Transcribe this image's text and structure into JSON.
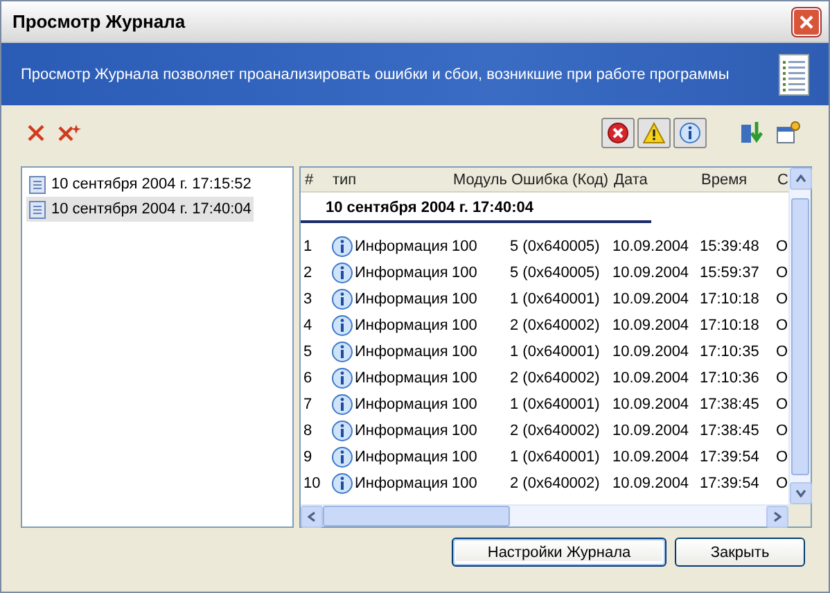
{
  "window": {
    "title": "Просмотр Журнала"
  },
  "banner": {
    "text": "Просмотр Журнала позволяет проанализировать ошибки и сбои, возникшие при работе программы"
  },
  "filters": [
    {
      "kind": "error"
    },
    {
      "kind": "warning"
    },
    {
      "kind": "info"
    }
  ],
  "sessions": [
    {
      "label": "10 сентября 2004 г. 17:15:52",
      "selected": false
    },
    {
      "label": "10 сентября 2004 г. 17:40:04",
      "selected": true
    }
  ],
  "table": {
    "columns": [
      "#",
      "тип",
      "Модуль",
      "Ошибка (Код)",
      "Дата",
      "Время",
      "С"
    ],
    "group": "10 сентября 2004 г. 17:40:04",
    "rows": [
      {
        "kind": "info",
        "cells": [
          "1",
          "Информация",
          "100",
          "5 (0x640005)",
          "10.09.2004",
          "15:39:48",
          "О"
        ]
      },
      {
        "kind": "info",
        "cells": [
          "2",
          "Информация",
          "100",
          "5 (0x640005)",
          "10.09.2004",
          "15:59:37",
          "О"
        ]
      },
      {
        "kind": "info",
        "cells": [
          "3",
          "Информация",
          "100",
          "1 (0x640001)",
          "10.09.2004",
          "17:10:18",
          "О"
        ]
      },
      {
        "kind": "info",
        "cells": [
          "4",
          "Информация",
          "100",
          "2 (0x640002)",
          "10.09.2004",
          "17:10:18",
          "О"
        ]
      },
      {
        "kind": "info",
        "cells": [
          "5",
          "Информация",
          "100",
          "1 (0x640001)",
          "10.09.2004",
          "17:10:35",
          "О"
        ]
      },
      {
        "kind": "info",
        "cells": [
          "6",
          "Информация",
          "100",
          "2 (0x640002)",
          "10.09.2004",
          "17:10:36",
          "О"
        ]
      },
      {
        "kind": "info",
        "cells": [
          "7",
          "Информация",
          "100",
          "1 (0x640001)",
          "10.09.2004",
          "17:38:45",
          "О"
        ]
      },
      {
        "kind": "info",
        "cells": [
          "8",
          "Информация",
          "100",
          "2 (0x640002)",
          "10.09.2004",
          "17:38:45",
          "О"
        ]
      },
      {
        "kind": "info",
        "cells": [
          "9",
          "Информация",
          "100",
          "1 (0x640001)",
          "10.09.2004",
          "17:39:54",
          "О"
        ]
      },
      {
        "kind": "info",
        "cells": [
          "10",
          "Информация",
          "100",
          "2 (0x640002)",
          "10.09.2004",
          "17:39:54",
          "О"
        ]
      }
    ]
  },
  "buttons": [
    {
      "label": "Настройки Журнала",
      "selected": true
    },
    {
      "label": "Закрыть",
      "selected": false
    }
  ]
}
